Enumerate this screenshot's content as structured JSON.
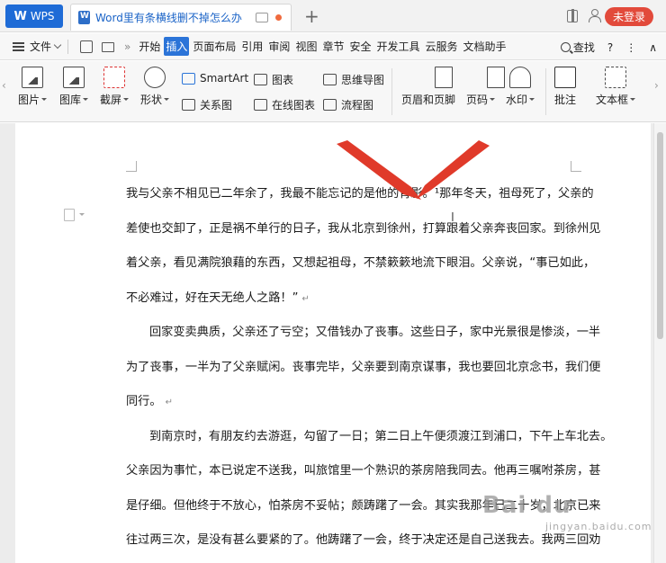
{
  "tabs": {
    "app_button": "WPS",
    "doc_title": "Word里有条横线删不掉怎么办",
    "login": "未登录"
  },
  "menu": {
    "file_label": "文件",
    "items": [
      "开始",
      "插入",
      "页面布局",
      "引用",
      "审阅",
      "视图",
      "章节",
      "安全",
      "开发工具",
      "云服务",
      "文档助手"
    ],
    "active_index": 1,
    "search_label": "查找",
    "help": "?",
    "more": "⋮",
    "collapse": "∧"
  },
  "ribbon": {
    "picture": "图片",
    "gallery": "图库",
    "screenshot": "截屏",
    "shapes": "形状",
    "smartart": "SmartArt",
    "chart": "图表",
    "mindmap": "思维导图",
    "relation": "关系图",
    "online_chart": "在线图表",
    "flowchart": "流程图",
    "header_footer": "页眉和页脚",
    "page_num": "页码",
    "watermark": "水印",
    "comment": "批注",
    "textbox": "文本框"
  },
  "document": {
    "lines": [
      "我与父亲不相见已二年余了，我最不能忘记的是他的背影。¹那年冬天，祖母死了，父亲的",
      "差使也交卸了，正是祸不单行的日子，我从北京到徐州，打算跟着父亲奔丧回家。到徐州见",
      "着父亲，看见满院狼藉的东西，又想起祖母，不禁簌簌地流下眼泪。父亲说，“事已如此，",
      "不必难过，好在天无绝人之路！”",
      "回家变卖典质，父亲还了亏空；又借钱办了丧事。这些日子，家中光景很是惨淡，一半",
      "为了丧事，一半为了父亲赋闲。丧事完毕，父亲要到南京谋事，我也要回北京念书，我们便",
      "同行。",
      "到南京时，有朋友约去游逛，勾留了一日；第二日上午便须渡江到浦口，下午上车北去。",
      "父亲因为事忙，本已说定不送我，叫旅馆里一个熟识的茶房陪我同去。他再三嘱咐茶房，甚",
      "是仔细。但他终于不放心，怕茶房不妥帖；颇踌躇了一会。其实我那年已二十岁，北京已来",
      "往过两三次，是没有甚么要紧的了。他踌躇了一会，终于决定还是自己送我去。我两三回劝"
    ],
    "para_mark": "↵",
    "cursor": "I"
  },
  "watermark": {
    "brand": "Bai du",
    "sub": "jingyan.baidu.com"
  },
  "colors": {
    "accent": "#2b74d8",
    "login": "#e24a3b",
    "arrow": "#e03a2a"
  }
}
